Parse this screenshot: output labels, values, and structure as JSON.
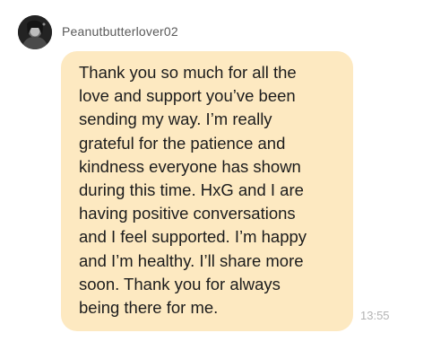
{
  "sender": {
    "username": "Peanutbutterlover02",
    "avatar_icon": "profile-photo"
  },
  "message": {
    "text": "Thank you so much for all the\nlove and support you’ve been\nsending my way. I’m really\ngrateful for the patience and\nkindness everyone has shown\nduring this time.  HxG and I are\nhaving positive conversations\nand I feel supported. I’m happy\nand I’m healthy.  I’ll share more\nsoon. Thank you for always\nbeing there for me.",
    "time": "13:55"
  },
  "colors": {
    "bubble_background": "#fde9c1",
    "page_background": "#ffffff",
    "timestamp": "#b4b4b4"
  }
}
